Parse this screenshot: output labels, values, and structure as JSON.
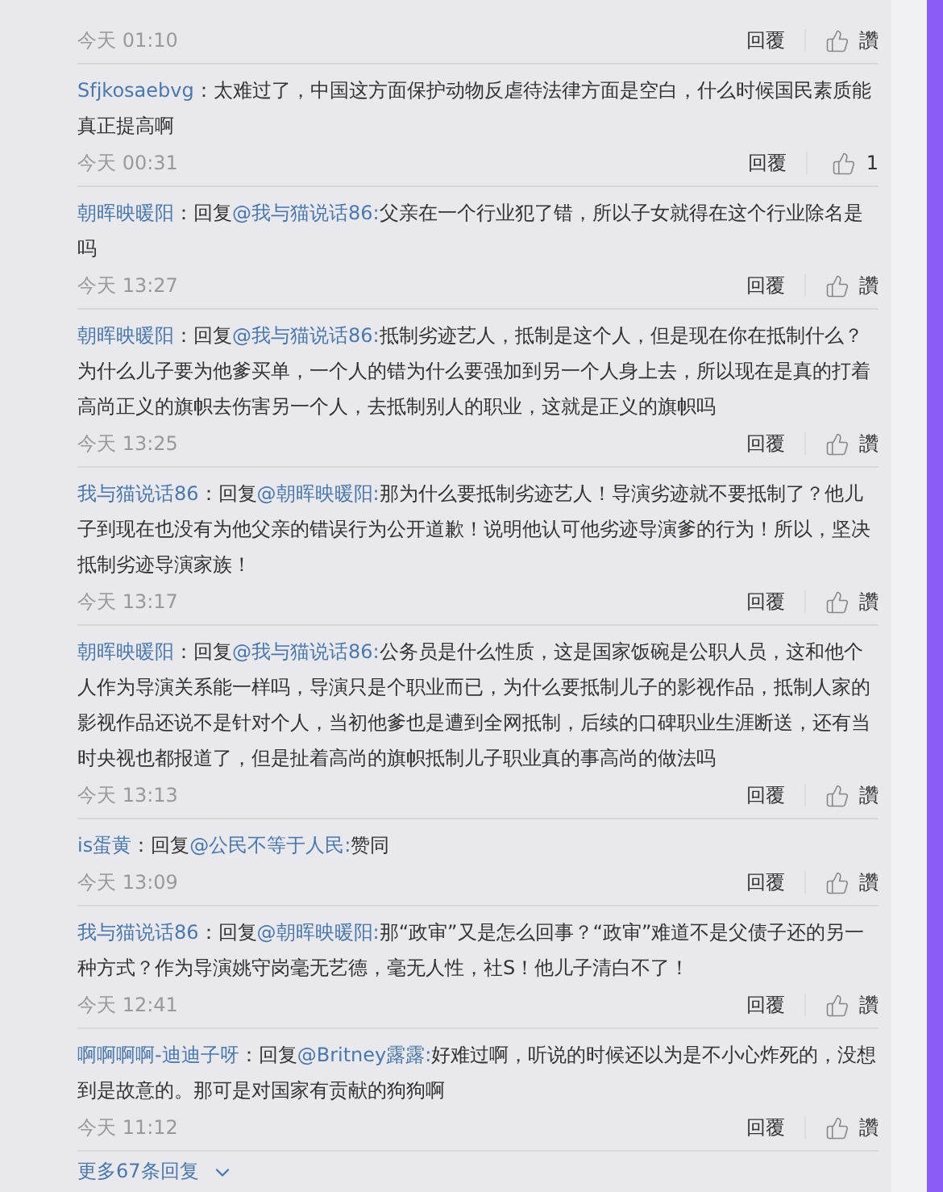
{
  "top_item": {
    "time": "今天 01:10",
    "reply_label": "回覆",
    "like_label": "讚"
  },
  "comments": [
    {
      "author": "Sfjkosaebvg",
      "lead": "：",
      "text": "太难过了，中国这方面保护动物反虐待法律方面是空白，什么时候国民素质能真正提高啊",
      "time": "今天 00:31",
      "reply_label": "回覆",
      "like_label": "1"
    },
    {
      "author": "朝晖映暖阳",
      "lead": "：回复",
      "mention": "@我与猫说话86:",
      "text": "父亲在一个行业犯了错，所以子女就得在这个行业除名是吗",
      "time": "今天 13:27",
      "reply_label": "回覆",
      "like_label": "讚"
    },
    {
      "author": "朝晖映暖阳",
      "lead": "：回复",
      "mention": "@我与猫说话86:",
      "text": "抵制劣迹艺人，抵制是这个人，但是现在你在抵制什么？为什么儿子要为他爹买单，一个人的错为什么要强加到另一个人身上去，所以现在是真的打着高尚正义的旗帜去伤害另一个人，去抵制别人的职业，这就是正义的旗帜吗",
      "time": "今天 13:25",
      "reply_label": "回覆",
      "like_label": "讚"
    },
    {
      "author": "我与猫说话86",
      "lead": "：回复",
      "mention": "@朝晖映暖阳:",
      "text": "那为什么要抵制劣迹艺人！导演劣迹就不要抵制了？他儿子到现在也没有为他父亲的错误行为公开道歉！说明他认可他劣迹导演爹的行为！所以，坚决抵制劣迹导演家族！",
      "time": "今天 13:17",
      "reply_label": "回覆",
      "like_label": "讚"
    },
    {
      "author": "朝晖映暖阳",
      "lead": "：回复",
      "mention": "@我与猫说话86:",
      "text": "公务员是什么性质，这是国家饭碗是公职人员，这和他个人作为导演关系能一样吗，导演只是个职业而已，为什么要抵制儿子的影视作品，抵制人家的影视作品还说不是针对个人，当初他爹也是遭到全网抵制，后续的口碑职业生涯断送，还有当时央视也都报道了，但是扯着高尚的旗帜抵制儿子职业真的事高尚的做法吗",
      "time": "今天 13:13",
      "reply_label": "回覆",
      "like_label": "讚"
    },
    {
      "author": "is蛋黄",
      "lead": "：回复",
      "mention": "@公民不等于人民:",
      "text": "赞同",
      "time": "今天 13:09",
      "reply_label": "回覆",
      "like_label": "讚"
    },
    {
      "author": "我与猫说话86",
      "lead": "：回复",
      "mention": "@朝晖映暖阳:",
      "text": "那“政审”又是怎么回事？“政审”难道不是父债子还的另一种方式？作为导演姚守岗毫无艺德，毫无人性，社S！他儿子清白不了！",
      "time": "今天 12:41",
      "reply_label": "回覆",
      "like_label": "讚"
    },
    {
      "author": "啊啊啊啊-迪迪子呀",
      "lead": "：回复",
      "mention": "@Britney露露:",
      "text": "好难过啊，听说的时候还以为是不小心炸死的，没想到是故意的。那可是对国家有贡献的狗狗啊",
      "time": "今天 11:12",
      "reply_label": "回覆",
      "like_label": "讚"
    }
  ],
  "more_replies": "更多67条回复"
}
